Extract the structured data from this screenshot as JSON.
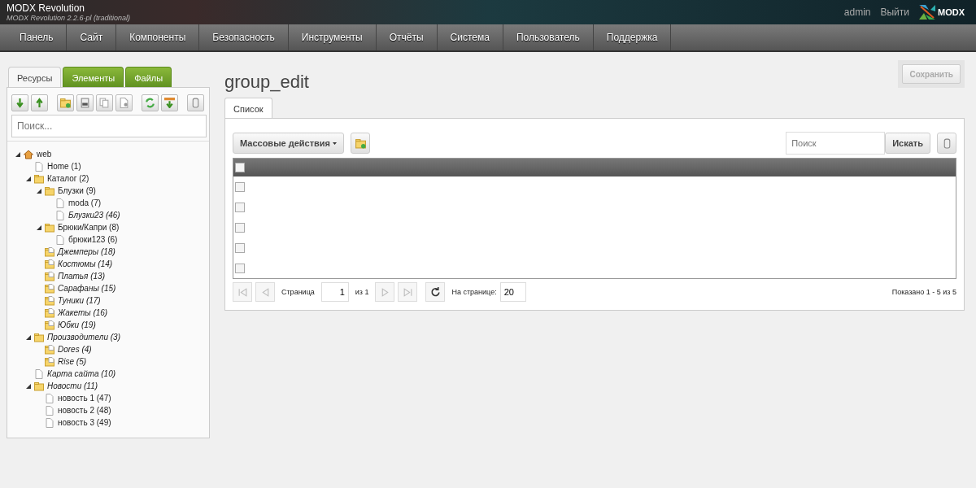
{
  "header": {
    "title": "MODX Revolution",
    "subtitle": "MODX Revolution 2.2.6-pl (traditional)",
    "user": "admin",
    "logout": "Выйти",
    "logo": "MODX"
  },
  "nav": [
    "Панель",
    "Сайт",
    "Компоненты",
    "Безопасность",
    "Инструменты",
    "Отчёты",
    "Система",
    "Пользователь",
    "Поддержка"
  ],
  "sidebar": {
    "tabs": [
      {
        "label": "Ресурсы",
        "selected": true
      },
      {
        "label": "Элементы",
        "selected": false
      },
      {
        "label": "Файлы",
        "selected": false
      }
    ],
    "search": {
      "placeholder": "Поиск..."
    },
    "tree": [
      {
        "kind": "home",
        "label": "web",
        "published": true,
        "expanded": true,
        "children": [
          {
            "kind": "doc",
            "label": "Home",
            "count": "(1)",
            "published": true,
            "expanded": false
          },
          {
            "kind": "folder",
            "label": "Каталог",
            "count": "(2)",
            "published": true,
            "expanded": true,
            "children": [
              {
                "kind": "folder",
                "label": "Блузки",
                "count": "(9)",
                "published": true,
                "expanded": true,
                "children": [
                  {
                    "kind": "doc",
                    "label": "moda",
                    "count": "(7)",
                    "published": true,
                    "expanded": false
                  },
                  {
                    "kind": "doc",
                    "label": "Блузки23",
                    "count": "(46)",
                    "published": false,
                    "expanded": false
                  }
                ]
              },
              {
                "kind": "folder",
                "label": "Брюки/Капри",
                "count": "(8)",
                "published": true,
                "expanded": true,
                "children": [
                  {
                    "kind": "doc",
                    "label": "брюки123",
                    "count": "(6)",
                    "published": true,
                    "expanded": false
                  }
                ]
              },
              {
                "kind": "folderdoc",
                "label": "Джемперы",
                "count": "(18)",
                "published": false,
                "expanded": false
              },
              {
                "kind": "folderdoc",
                "label": "Костюмы",
                "count": "(14)",
                "published": false,
                "expanded": false
              },
              {
                "kind": "folderdoc",
                "label": "Платья",
                "count": "(13)",
                "published": false,
                "expanded": false
              },
              {
                "kind": "folderdoc",
                "label": "Сарафаны",
                "count": "(15)",
                "published": false,
                "expanded": false
              },
              {
                "kind": "folderdoc",
                "label": "Туники",
                "count": "(17)",
                "published": false,
                "expanded": false
              },
              {
                "kind": "folderdoc",
                "label": "Жакеты",
                "count": "(16)",
                "published": false,
                "expanded": false
              },
              {
                "kind": "folderdoc",
                "label": "Юбки",
                "count": "(19)",
                "published": false,
                "expanded": false
              }
            ]
          },
          {
            "kind": "folder",
            "label": "Производители",
            "count": "(3)",
            "published": false,
            "expanded": true,
            "children": [
              {
                "kind": "folderdoc",
                "label": "Dores",
                "count": "(4)",
                "published": false,
                "expanded": false
              },
              {
                "kind": "folderdoc",
                "label": "Rise",
                "count": "(5)",
                "published": false,
                "expanded": false
              }
            ]
          },
          {
            "kind": "doc",
            "label": "Карта сайта",
            "count": "(10)",
            "published": false,
            "expanded": false
          },
          {
            "kind": "folder",
            "label": "Новости",
            "count": "(11)",
            "published": false,
            "expanded": true,
            "children": [
              {
                "kind": "doc",
                "label": "новость 1",
                "count": "(47)",
                "published": true,
                "expanded": false
              },
              {
                "kind": "doc",
                "label": "новость 2",
                "count": "(48)",
                "published": true,
                "expanded": false
              },
              {
                "kind": "doc",
                "label": "новость 3",
                "count": "(49)",
                "published": true,
                "expanded": false
              }
            ]
          }
        ]
      }
    ]
  },
  "page": {
    "title": "group_edit",
    "save": "Сохранить",
    "tabs": [
      {
        "label": "Список",
        "selected": true
      }
    ],
    "bulk": "Массовые действия",
    "search": {
      "placeholder": "Поиск"
    },
    "search_button": "Искать",
    "header_checkbox": {
      "checked": false
    },
    "rows": [
      {
        "checked": false
      },
      {
        "checked": false
      },
      {
        "checked": false
      },
      {
        "checked": false
      },
      {
        "checked": false
      }
    ],
    "pager": {
      "page_label": "Страница",
      "page": "1",
      "of": "из 1",
      "per_page_label": "На странице:",
      "per_page": "20",
      "summary": "Показано 1 - 5 из 5"
    }
  }
}
